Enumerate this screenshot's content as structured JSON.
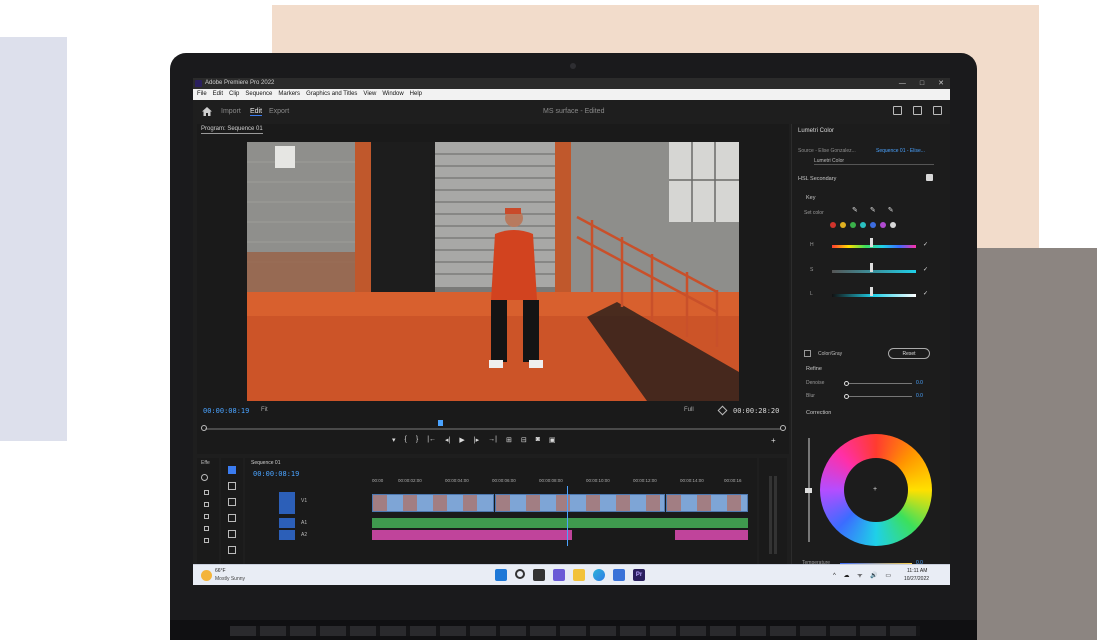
{
  "window": {
    "title": "Adobe Premiere Pro 2022",
    "controls": [
      "—",
      "□",
      "✕"
    ]
  },
  "menu": [
    "File",
    "Edit",
    "Clip",
    "Sequence",
    "Markers",
    "Graphics and Titles",
    "View",
    "Window",
    "Help"
  ],
  "workspace": {
    "tabs": [
      {
        "label": "Import",
        "active": false
      },
      {
        "label": "Edit",
        "active": true
      },
      {
        "label": "Export",
        "active": false
      }
    ],
    "document_title": "MS surface - Edited",
    "icons": [
      "panel-icon",
      "share-icon",
      "fullscreen-icon"
    ]
  },
  "program_monitor": {
    "tab_label": "Program: Sequence 01",
    "timecode_current": "00:00:08:19",
    "fit": "Fit",
    "resolution": "Full",
    "timecode_duration": "00:00:28:20",
    "transport": [
      "▾",
      "{",
      "}",
      "|←",
      "◂|",
      "▶",
      "|▸",
      "→|",
      "⊞",
      "⊟",
      "◙",
      "▣"
    ],
    "add_label": "+"
  },
  "lumetri": {
    "title": "Lumetri Color",
    "source": "Source - Elise Gonzalez...",
    "sequence": "Sequence 01 - Elise...",
    "effect": "Lumetri Color",
    "section_hsl": "HSL Secondary",
    "section_key": "Key",
    "set_color": "Set color",
    "hsl_rows": [
      "H",
      "S",
      "L"
    ],
    "swatch_colors": [
      "#d0342c",
      "#e0b020",
      "#3ab04a",
      "#2ac0c0",
      "#3c6ce0",
      "#b04ad0",
      "#d8d8d8"
    ],
    "color_gray": "Color/Gray",
    "reset": "Reset",
    "section_refine": "Refine",
    "denoise": {
      "label": "Denoise",
      "value": "0.0"
    },
    "blur": {
      "label": "Blur",
      "value": "0.0"
    },
    "section_correction": "Correction",
    "temperature": {
      "label": "Temperature",
      "value": "0.0"
    }
  },
  "effects_panel": {
    "label": "Effe"
  },
  "timeline": {
    "tab_label": "Sequence 01",
    "timecode": "00:00:08:19",
    "ruler": [
      "00:00",
      "00:00:02:00",
      "00:00:04:00",
      "00:00:06:00",
      "00:00:08:00",
      "00:00:10:00",
      "00:00:12:00",
      "00:00:14:00",
      "00:00:16"
    ],
    "track_labels": [
      "V1",
      "A1",
      "A2"
    ]
  },
  "taskbar": {
    "weather_temp": "66°F",
    "weather_desc": "Mostly Sunny",
    "clock_time": "11:11 AM",
    "clock_date": "10/27/2022",
    "tray": "^ ☁ ᯤ 🔊 ▭",
    "app_icons": [
      "windows-start-icon",
      "search-icon",
      "task-view-icon",
      "teams-icon",
      "file-explorer-icon",
      "edge-icon",
      "store-icon",
      "premiere-icon"
    ]
  },
  "colors": {
    "accent_blue": "#4aa3ff",
    "premiere_purple": "#2a1f5e"
  }
}
